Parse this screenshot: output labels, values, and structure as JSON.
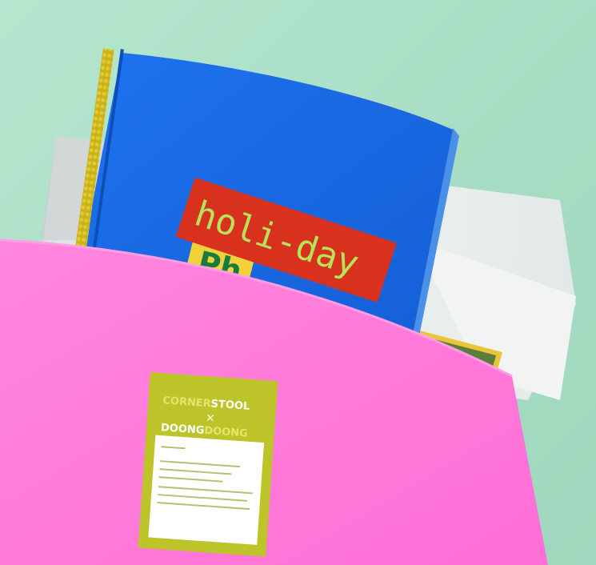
{
  "book": {
    "title": "holi-day",
    "tab_text": "Ph"
  },
  "sticker": {
    "line1_a": "CORNER",
    "line1_b": "STOOL",
    "line2": "×",
    "line3_a": "DOONG",
    "line3_b": "DOONG"
  },
  "colors": {
    "background": "#a9dfc6",
    "envelope": "#ff7bd9",
    "book_cover": "#1a6ee6",
    "title_label": "#d8321e",
    "title_text": "#b6e35a",
    "sticker": "#bcc42a"
  }
}
